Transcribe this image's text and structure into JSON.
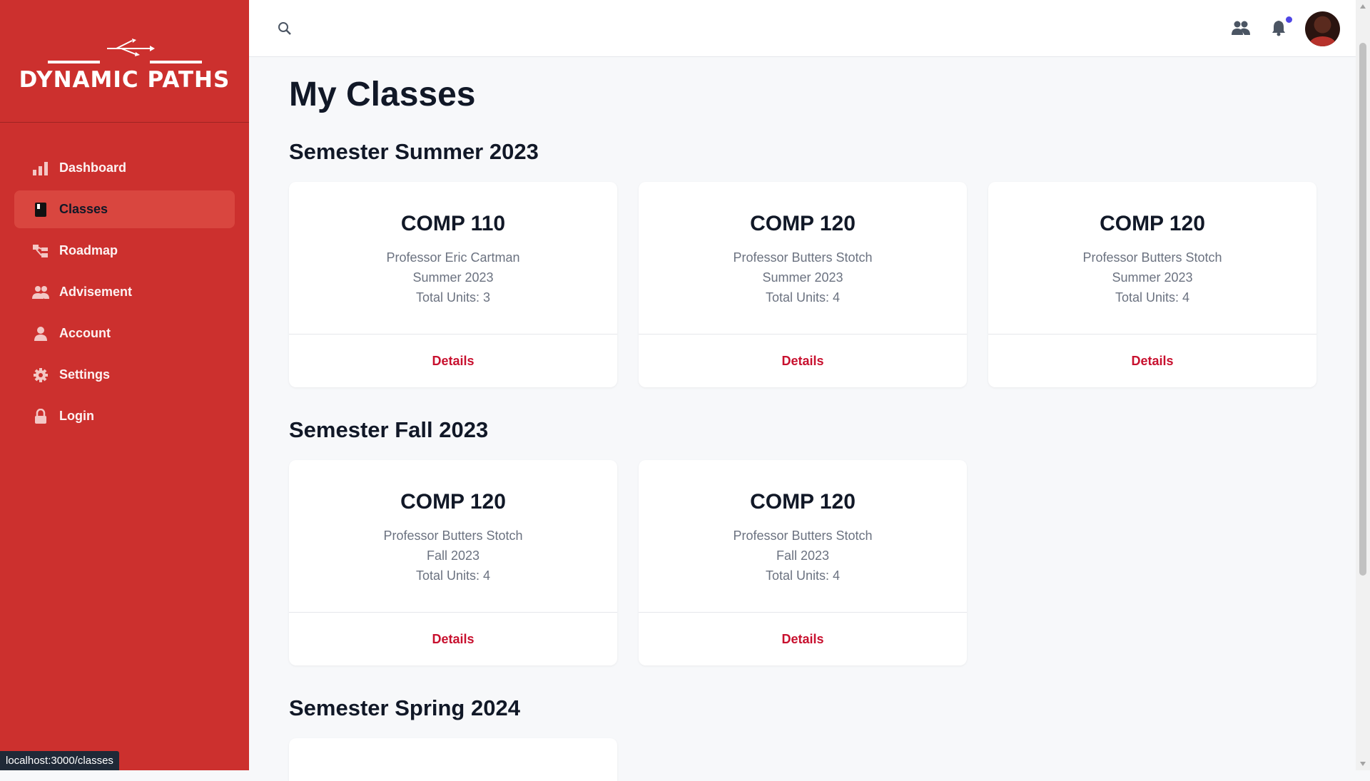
{
  "brand": {
    "name": "DYNAMIC PATHS"
  },
  "sidebar": {
    "items": [
      {
        "label": "Dashboard",
        "icon": "bar-chart-icon",
        "active": false
      },
      {
        "label": "Classes",
        "icon": "book-icon",
        "active": true
      },
      {
        "label": "Roadmap",
        "icon": "roadmap-icon",
        "active": false
      },
      {
        "label": "Advisement",
        "icon": "people-icon",
        "active": false
      },
      {
        "label": "Account",
        "icon": "user-icon",
        "active": false
      },
      {
        "label": "Settings",
        "icon": "gear-icon",
        "active": false
      },
      {
        "label": "Login",
        "icon": "lock-icon",
        "active": false
      }
    ]
  },
  "header": {
    "search_icon": "search-icon",
    "people_icon": "people-icon",
    "bell_icon": "bell-icon"
  },
  "page": {
    "title": "My Classes"
  },
  "semesters": [
    {
      "title": "Semester Summer 2023",
      "classes": [
        {
          "course": "COMP 110",
          "professor": "Professor Eric Cartman",
          "term": "Summer 2023",
          "units": "Total Units: 3",
          "action": "Details"
        },
        {
          "course": "COMP 120",
          "professor": "Professor Butters Stotch",
          "term": "Summer 2023",
          "units": "Total Units: 4",
          "action": "Details"
        },
        {
          "course": "COMP 120",
          "professor": "Professor Butters Stotch",
          "term": "Summer 2023",
          "units": "Total Units: 4",
          "action": "Details"
        }
      ]
    },
    {
      "title": "Semester Fall 2023",
      "classes": [
        {
          "course": "COMP 120",
          "professor": "Professor Butters Stotch",
          "term": "Fall 2023",
          "units": "Total Units: 4",
          "action": "Details"
        },
        {
          "course": "COMP 120",
          "professor": "Professor Butters Stotch",
          "term": "Fall 2023",
          "units": "Total Units: 4",
          "action": "Details"
        }
      ]
    },
    {
      "title": "Semester Spring 2024"
    }
  ],
  "status_bar": {
    "url": "localhost:3000/classes"
  },
  "colors": {
    "sidebar": "#cc302e",
    "active_item": "#d9463f",
    "accent": "#c8102e",
    "notification_dot": "#4f46e5"
  }
}
